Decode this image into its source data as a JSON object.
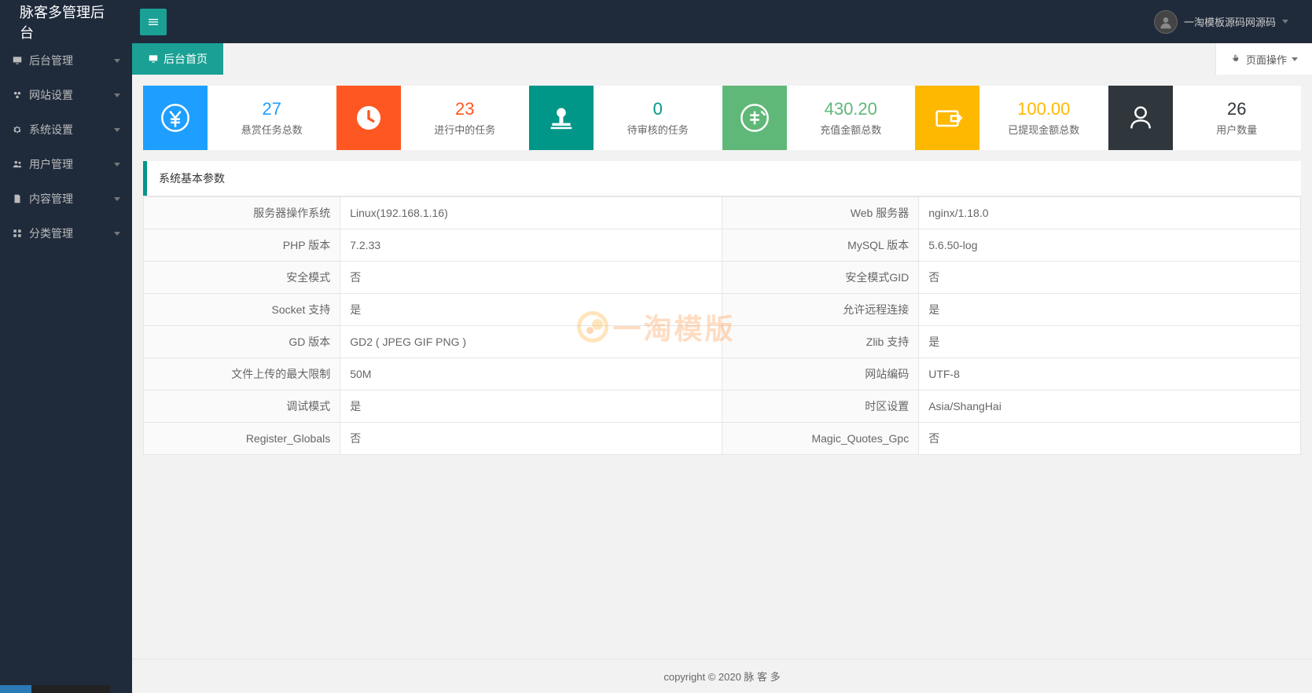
{
  "header": {
    "title": "脉客多管理后台",
    "user_name": "一淘模板源码网源码"
  },
  "sidebar": {
    "items": [
      {
        "label": "后台管理",
        "icon": "monitor"
      },
      {
        "label": "网站设置",
        "icon": "gear-cluster"
      },
      {
        "label": "系统设置",
        "icon": "gear"
      },
      {
        "label": "用户管理",
        "icon": "users"
      },
      {
        "label": "内容管理",
        "icon": "doc"
      },
      {
        "label": "分类管理",
        "icon": "grid"
      }
    ]
  },
  "tabs": {
    "active": "后台首页",
    "page_ops": "页面操作"
  },
  "stats": [
    {
      "value": "27",
      "label": "悬赏任务总数",
      "color": "blue",
      "icon": "yen"
    },
    {
      "value": "23",
      "label": "进行中的任务",
      "color": "orange",
      "icon": "clock"
    },
    {
      "value": "0",
      "label": "待审核的任务",
      "color": "teal",
      "icon": "stamp"
    },
    {
      "value": "430.20",
      "label": "充值金额总数",
      "color": "green",
      "icon": "yen2"
    },
    {
      "value": "100.00",
      "label": "已提现金额总数",
      "color": "yellow",
      "icon": "wallet"
    },
    {
      "value": "26",
      "label": "用户数量",
      "color": "dark",
      "icon": "person"
    }
  ],
  "panel_title": "系统基本参数",
  "sys": {
    "rows": [
      {
        "l1": "服务器操作系统",
        "v1": "Linux(192.168.1.16)",
        "l2": "Web 服务器",
        "v2": "nginx/1.18.0"
      },
      {
        "l1": "PHP 版本",
        "v1": "7.2.33",
        "l2": "MySQL 版本",
        "v2": "5.6.50-log"
      },
      {
        "l1": "安全模式",
        "v1": "否",
        "l2": "安全模式GID",
        "v2": "否"
      },
      {
        "l1": "Socket 支持",
        "v1": "是",
        "l2": "允许远程连接",
        "v2": "是"
      },
      {
        "l1": "GD 版本",
        "v1": "GD2 ( JPEG GIF PNG )",
        "l2": "Zlib 支持",
        "v2": "是"
      },
      {
        "l1": "文件上传的最大限制",
        "v1": "50M",
        "l2": "网站编码",
        "v2": "UTF-8"
      },
      {
        "l1": "调试模式",
        "v1": "是",
        "l2": "时区设置",
        "v2": "Asia/ShangHai"
      },
      {
        "l1": "Register_Globals",
        "v1": "否",
        "l2": "Magic_Quotes_Gpc",
        "v2": "否"
      }
    ]
  },
  "footer": "copyright © 2020 脉 客 多",
  "watermark": "一淘模版"
}
